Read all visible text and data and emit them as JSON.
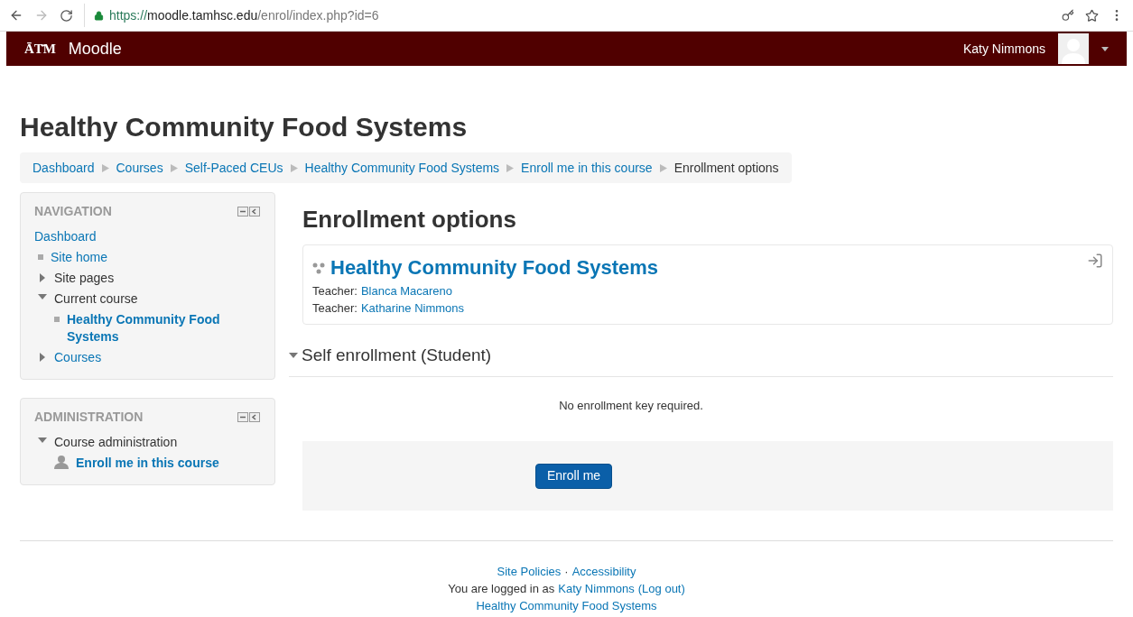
{
  "browser": {
    "url_scheme": "https://",
    "url_host": "moodle.tamhsc.edu",
    "url_path": "/enrol/index.php?id=6"
  },
  "navbar": {
    "brand_mark": "ĀТ̄М",
    "brand": "Moodle",
    "user": "Katy Nimmons"
  },
  "page_title": "Healthy Community Food Systems",
  "breadcrumb": [
    {
      "label": "Dashboard",
      "current": false
    },
    {
      "label": "Courses",
      "current": false
    },
    {
      "label": "Self-Paced CEUs",
      "current": false
    },
    {
      "label": "Healthy Community Food Systems",
      "current": false
    },
    {
      "label": "Enroll me in this course",
      "current": false
    },
    {
      "label": "Enrollment options",
      "current": true
    }
  ],
  "navigation": {
    "title": "NAVIGATION",
    "items": [
      {
        "label": "Dashboard",
        "kind": "plain",
        "link": true,
        "current": false
      },
      {
        "label": "Site home",
        "kind": "leaf",
        "link": true,
        "current": false
      },
      {
        "label": "Site pages",
        "kind": "branch",
        "expanded": false,
        "link": false,
        "current": false
      },
      {
        "label": "Current course",
        "kind": "branch",
        "expanded": true,
        "link": false,
        "current": false,
        "children": [
          {
            "label": "Healthy Community Food Systems",
            "kind": "leaf",
            "link": true,
            "current": true
          }
        ]
      },
      {
        "label": "Courses",
        "kind": "branch",
        "expanded": false,
        "link": true,
        "current": false
      }
    ]
  },
  "administration": {
    "title": "ADMINISTRATION",
    "items": [
      {
        "label": "Course administration",
        "kind": "branch",
        "expanded": true,
        "link": false,
        "current": false,
        "children": [
          {
            "label": "Enroll me in this course",
            "kind": "person",
            "link": true,
            "current": true
          }
        ]
      }
    ]
  },
  "main": {
    "heading": "Enrollment options",
    "course": {
      "name": "Healthy Community Food Systems",
      "teachers": [
        {
          "role": "Teacher:",
          "name": "Blanca Macareno"
        },
        {
          "role": "Teacher:",
          "name": "Katharine Nimmons"
        }
      ]
    },
    "section": {
      "title": "Self enrollment (Student)",
      "expanded": true,
      "note": "No enrollment key required.",
      "button": "Enroll me"
    }
  },
  "footer": {
    "links": [
      "Site Policies",
      "Accessibility"
    ],
    "separator": "·",
    "login_prefix": "You are logged in as",
    "user": "Katy Nimmons",
    "logout": "(Log out)",
    "course": "Healthy Community Food Systems"
  }
}
